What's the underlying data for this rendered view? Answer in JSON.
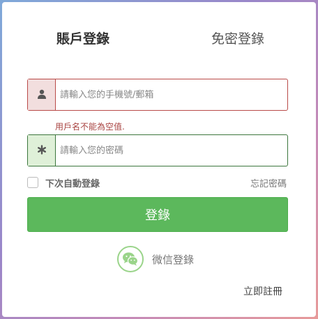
{
  "tabs": {
    "account_login": "賬戶登錄",
    "passwordless_login": "免密登錄"
  },
  "username": {
    "placeholder": "請輸入您的手機號/郵箱",
    "value": "",
    "icon": "user-icon",
    "error": "用戶名不能為空值."
  },
  "password": {
    "placeholder": "請輸入您的密碼",
    "value": "",
    "icon": "asterisk-icon"
  },
  "remember": {
    "label": "下次自動登錄",
    "checked": false
  },
  "forgot_password": "忘記密碼",
  "login_button": "登錄",
  "wechat": {
    "label": "微信登錄",
    "icon": "wechat-icon"
  },
  "register_link": "立即註冊",
  "colors": {
    "primary_button": "#5cb85c",
    "error": "#a94442",
    "error_bg": "#f2dede",
    "success": "#3c763d",
    "success_bg": "#dff0d8",
    "wechat": "#9ad48a"
  }
}
